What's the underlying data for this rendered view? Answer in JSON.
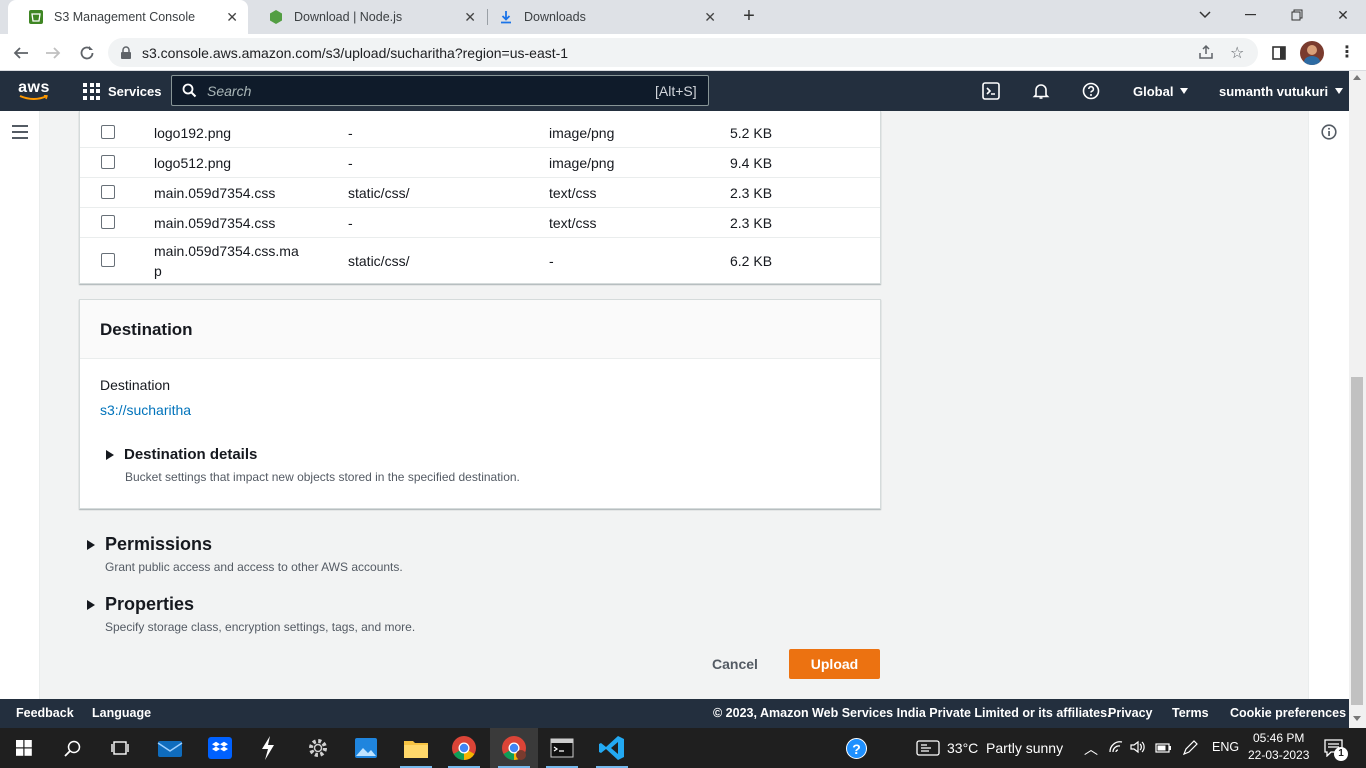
{
  "browser": {
    "tabs": [
      {
        "title": "S3 Management Console",
        "icon": "aws-s3-favicon",
        "active": true
      },
      {
        "title": "Download | Node.js",
        "icon": "nodejs-favicon",
        "active": false
      },
      {
        "title": "Downloads",
        "icon": "download-icon",
        "active": false
      }
    ],
    "url": "s3.console.aws.amazon.com/s3/upload/sucharitha?region=us-east-1"
  },
  "aws_nav": {
    "logo": "aws",
    "services_label": "Services",
    "search_placeholder": "Search",
    "search_shortcut": "[Alt+S]",
    "region": "Global",
    "user": "sumanth vutukuri"
  },
  "files": [
    {
      "name": "logo192.png",
      "folder": "-",
      "type": "image/png",
      "size": "5.2 KB"
    },
    {
      "name": "logo512.png",
      "folder": "-",
      "type": "image/png",
      "size": "9.4 KB"
    },
    {
      "name": "main.059d7354.css",
      "folder": "static/css/",
      "type": "text/css",
      "size": "2.3 KB"
    },
    {
      "name": "main.059d7354.css",
      "folder": "-",
      "type": "text/css",
      "size": "2.3 KB"
    },
    {
      "name_line1": "main.059d7354.css.ma",
      "name_line2": "p",
      "folder": "static/css/",
      "type": "-",
      "size": "6.2 KB"
    }
  ],
  "destination": {
    "heading": "Destination",
    "label": "Destination",
    "link": "s3://sucharitha",
    "details_title": "Destination details",
    "details_desc": "Bucket settings that impact new objects stored in the specified destination."
  },
  "permissions": {
    "title": "Permissions",
    "desc": "Grant public access and access to other AWS accounts."
  },
  "properties": {
    "title": "Properties",
    "desc": "Specify storage class, encryption settings, tags, and more."
  },
  "actions": {
    "cancel": "Cancel",
    "upload": "Upload"
  },
  "footer": {
    "feedback": "Feedback",
    "language": "Language",
    "copyright": "© 2023, Amazon Web Services India Private Limited or its affiliates.",
    "privacy": "Privacy",
    "terms": "Terms",
    "cookies": "Cookie preferences"
  },
  "taskbar": {
    "weather": "33°C  Partly sunny",
    "lang": "ENG",
    "time": "05:46 PM",
    "date": "22-03-2023",
    "notification_count": "1"
  },
  "colors": {
    "aws_nav": "#232f3e",
    "link": "#0073bb",
    "upload_button": "#ec7211"
  }
}
